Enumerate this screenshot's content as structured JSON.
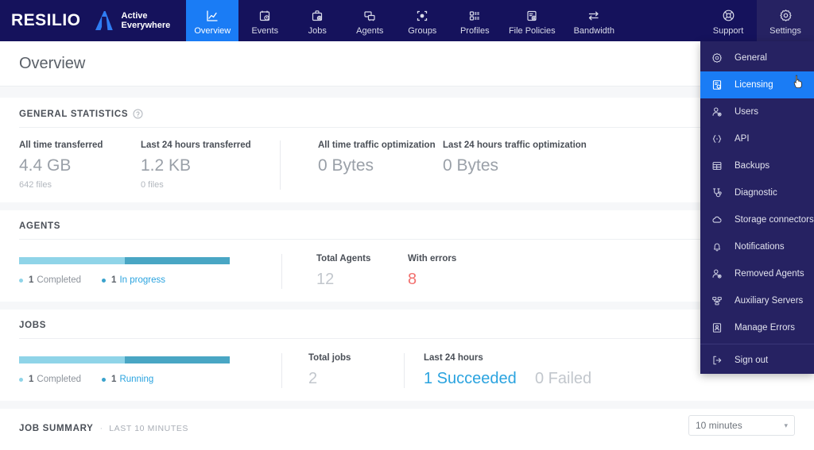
{
  "brand": {
    "name": "RESILIO",
    "product_line1": "Active",
    "product_line2": "Everywhere"
  },
  "topnav": {
    "items": [
      {
        "label": "Overview",
        "icon": "chart-line-icon",
        "active": true
      },
      {
        "label": "Events",
        "icon": "calendar-clock-icon",
        "active": false
      },
      {
        "label": "Jobs",
        "icon": "briefcase-gear-icon",
        "active": false
      },
      {
        "label": "Agents",
        "icon": "agents-icon",
        "active": false
      },
      {
        "label": "Groups",
        "icon": "groups-icon",
        "active": false
      },
      {
        "label": "Profiles",
        "icon": "profiles-list-icon",
        "active": false
      },
      {
        "label": "File Policies",
        "icon": "file-policy-icon",
        "active": false
      },
      {
        "label": "Bandwidth",
        "icon": "bandwidth-arrows-icon",
        "active": false
      }
    ],
    "right_items": [
      {
        "label": "Support",
        "icon": "lifebuoy-icon",
        "active": false
      },
      {
        "label": "Settings",
        "icon": "gear-icon",
        "active": true
      }
    ]
  },
  "settings_menu": {
    "items": [
      {
        "label": "General",
        "icon": "gear-icon",
        "selected": false
      },
      {
        "label": "Licensing",
        "icon": "license-document-icon",
        "selected": true
      },
      {
        "label": "Users",
        "icon": "user-gear-icon",
        "selected": false
      },
      {
        "label": "API",
        "icon": "api-braces-icon",
        "selected": false
      },
      {
        "label": "Backups",
        "icon": "database-backup-icon",
        "selected": false
      },
      {
        "label": "Diagnostic",
        "icon": "stethoscope-icon",
        "selected": false
      },
      {
        "label": "Storage connectors",
        "icon": "cloud-icon",
        "selected": false
      },
      {
        "label": "Notifications",
        "icon": "bell-icon",
        "selected": false
      },
      {
        "label": "Removed Agents",
        "icon": "user-gear-icon",
        "selected": false
      },
      {
        "label": "Auxiliary Servers",
        "icon": "servers-icon",
        "selected": false
      },
      {
        "label": "Manage Errors",
        "icon": "error-document-icon",
        "selected": false
      }
    ],
    "signout": {
      "label": "Sign out",
      "icon": "sign-out-icon"
    }
  },
  "page": {
    "title": "Overview"
  },
  "general_statistics": {
    "title": "GENERAL STATISTICS",
    "help_icon": "question-circle-icon",
    "stats": [
      {
        "label": "All time transferred",
        "value": "4.4 GB",
        "sub": "642 files"
      },
      {
        "label": "Last 24 hours transferred",
        "value": "1.2 KB",
        "sub": "0 files"
      },
      {
        "label": "All time traffic optimization",
        "value": "0 Bytes",
        "sub": ""
      },
      {
        "label": "Last 24 hours traffic optimization",
        "value": "0 Bytes",
        "sub": ""
      }
    ]
  },
  "agents": {
    "title": "AGENTS",
    "bar": {
      "completed_pct": 50,
      "in_progress_pct": 50
    },
    "legend": [
      {
        "count": "1",
        "label": "Completed",
        "link": false
      },
      {
        "count": "1",
        "label": "In progress",
        "link": true
      }
    ],
    "metrics": [
      {
        "label": "Total Agents",
        "value": "12",
        "style": "muted"
      },
      {
        "label": "With errors",
        "value": "8",
        "style": "error"
      }
    ]
  },
  "jobs": {
    "title": "JOBS",
    "bar": {
      "completed_pct": 50,
      "running_pct": 50
    },
    "legend": [
      {
        "count": "1",
        "label": "Completed",
        "link": false
      },
      {
        "count": "1",
        "label": "Running",
        "link": true
      }
    ],
    "total": {
      "label": "Total jobs",
      "value": "2"
    },
    "last24": {
      "label": "Last 24 hours",
      "succeeded": "1 Succeeded",
      "failed": "0 Failed"
    }
  },
  "job_summary": {
    "title": "JOB SUMMARY",
    "subtitle": "LAST 10 MINUTES",
    "range_select": {
      "value": "10 minutes",
      "caret": "▾"
    }
  },
  "colors": {
    "nav_bg": "#15125c",
    "accent_blue": "#1a7cf5",
    "menu_bg": "#262262",
    "bar_light": "#8fd4e8",
    "bar_dark": "#49a6c4",
    "error_red": "#f2706e",
    "link_blue": "#2aa3df"
  }
}
